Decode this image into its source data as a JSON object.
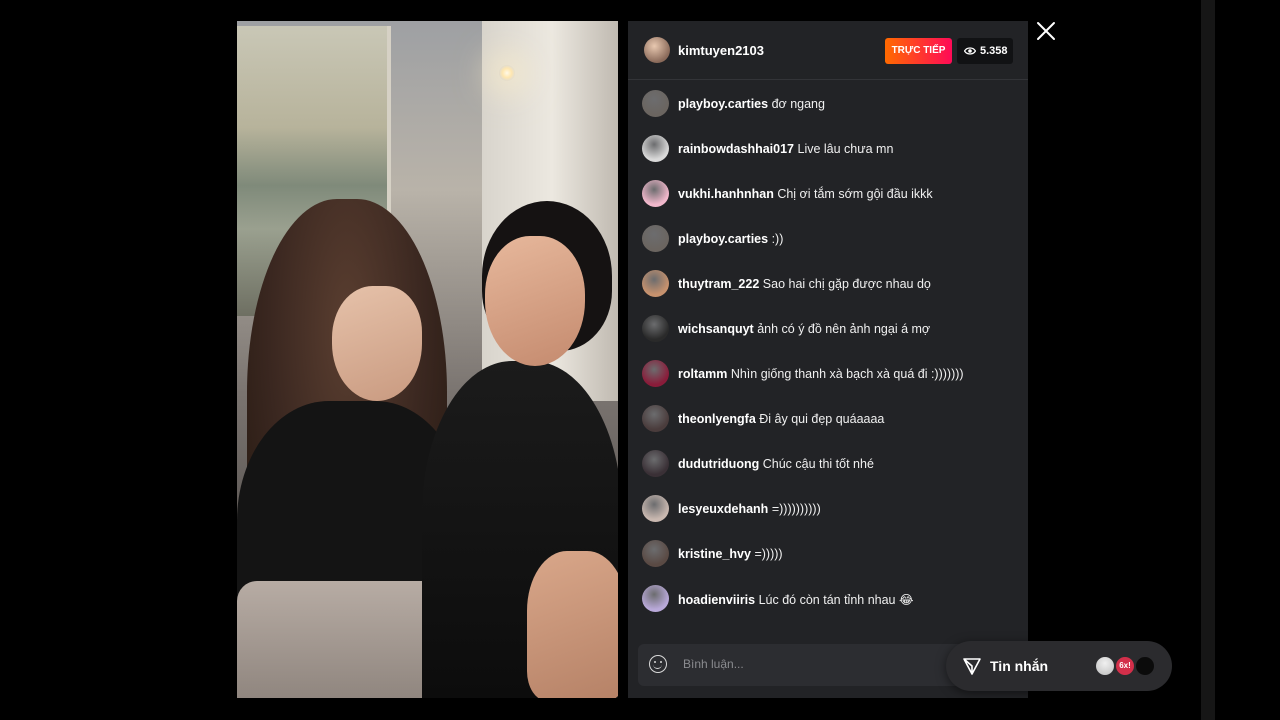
{
  "stream": {
    "host_username": "kimtuyen2103",
    "live_label": "TRỰC TIẾP",
    "viewer_count": "5.358",
    "viewer_icon": "eye-icon",
    "close_icon": "close-icon"
  },
  "comments": [
    {
      "user": "playboy.carties",
      "text": "đơ ngang",
      "avatar_color": "#6b6560"
    },
    {
      "user": "rainbowdashhai017",
      "text": "Live lâu chưa mn",
      "avatar_color": "#d9d9d9"
    },
    {
      "user": "vukhi.hanhnhan",
      "text": "Chị ơi tắm sớm gội đầu ikkk",
      "avatar_color": "#f2b8cc"
    },
    {
      "user": "playboy.carties",
      "text": ":))",
      "avatar_color": "#6b6560"
    },
    {
      "user": "thuytram_222",
      "text": "Sao hai chị gặp được nhau dọ",
      "avatar_color": "#c7926e"
    },
    {
      "user": "wichsanquyt",
      "text": "ảnh có ý đồ nên ảnh ngại á mợ",
      "avatar_color": "#2a2a2a"
    },
    {
      "user": "roltamm",
      "text": "Nhìn giống thanh xà bạch xà quá đi :)))))))",
      "avatar_color": "#8a1c3a"
    },
    {
      "user": "theonlyengfa",
      "text": "Đi ây qui đẹp quáaaaa",
      "avatar_color": "#4a3c3c"
    },
    {
      "user": "dudutriduong",
      "text": "Chúc cậu thi tốt nhé",
      "avatar_color": "#3a3036"
    },
    {
      "user": "lesyeuxdehanh",
      "text": "=))))))))))",
      "avatar_color": "#c9b8b0"
    },
    {
      "user": "kristine_hvy",
      "text": "=)))))",
      "avatar_color": "#5a4a44"
    },
    {
      "user": "hoadienviiris",
      "text": "Lúc đó còn tán tỉnh nhau 😂",
      "avatar_color": "#b9a9d9"
    }
  ],
  "input": {
    "placeholder": "Bình luận...",
    "emoji_icon": "smile-icon"
  },
  "messages_pill": {
    "label": "Tin nhắn",
    "icon": "send-icon",
    "badge_text": "6x!"
  }
}
